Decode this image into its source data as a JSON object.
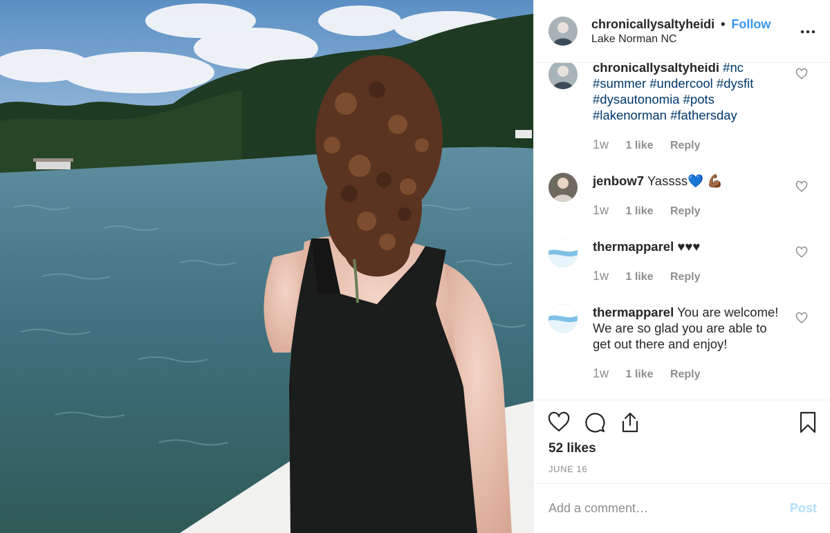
{
  "post": {
    "username": "chronicallysaltyheidi",
    "separator": "•",
    "follow_label": "Follow",
    "location": "Lake Norman NC",
    "more_icon": "more-options-icon"
  },
  "comments": [
    {
      "username": "chronicallysaltyheidi",
      "line1_tags": "#nc",
      "line2": "#summer #undercool #dysfit",
      "line3": "#dysautonomia #pots",
      "line4": "#lakenorman #fathersday",
      "time": "1w",
      "likes": "1 like",
      "reply": "Reply"
    },
    {
      "username": "jenbow7",
      "text": "Yassss💙 💪🏾",
      "time": "1w",
      "likes": "1 like",
      "reply": "Reply"
    },
    {
      "username": "thermapparel",
      "text": "♥♥♥",
      "time": "1w",
      "likes": "1 like",
      "reply": "Reply"
    },
    {
      "username": "thermapparel",
      "text": "You are welcome! We are so glad you are able to get out there and enjoy!",
      "time": "1w",
      "likes": "1 like",
      "reply": "Reply"
    }
  ],
  "actions": {
    "like_icon": "heart-icon",
    "comment_icon": "comment-bubble-icon",
    "share_icon": "share-icon",
    "save_icon": "bookmark-icon",
    "likes_count": "52 likes",
    "date": "JUNE 16"
  },
  "add_comment": {
    "placeholder": "Add a comment…",
    "post_label": "Post"
  },
  "colors": {
    "link_blue": "#3897f0",
    "hashtag": "#00376b",
    "muted": "#8e8e8e",
    "post_disabled": "#b2dffc"
  }
}
